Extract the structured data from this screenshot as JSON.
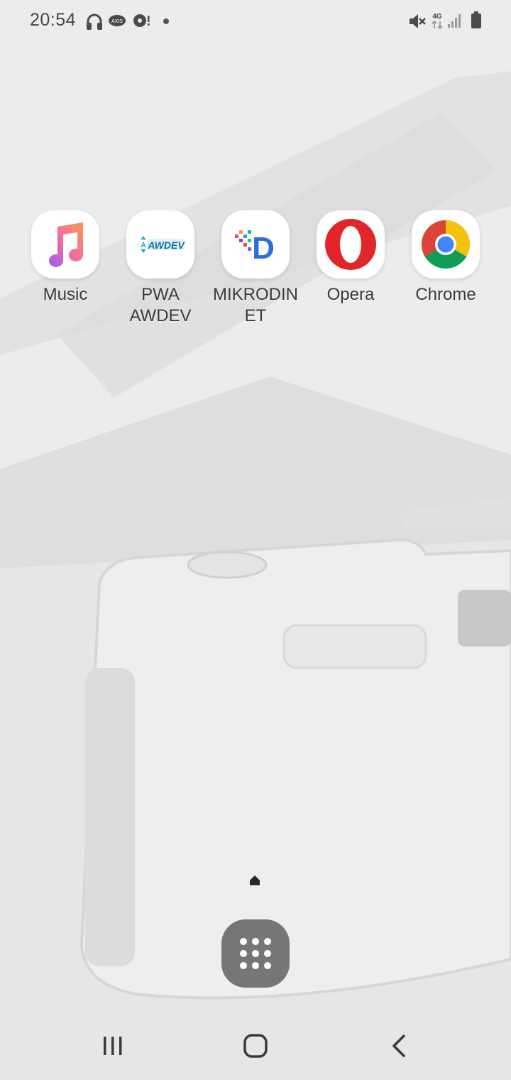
{
  "status_bar": {
    "time": "20:54",
    "carrier_badge": "AXIS",
    "network_type": "4G",
    "left_icons": [
      "headphones-icon",
      "carrier-axis-icon",
      "chat-bubble-icon",
      "notification-dot"
    ],
    "right_icons": [
      "mute-icon",
      "network-4g-icon",
      "signal-icon",
      "battery-icon"
    ]
  },
  "apps": [
    {
      "label": "Music",
      "icon": "music-note-icon"
    },
    {
      "label": "PWA AWDEV",
      "icon": "awdev-logo-icon",
      "logo_text": "AWDEV"
    },
    {
      "label": "MIKRODINET",
      "icon": "mikrodinet-logo-icon",
      "logo_text": "D"
    },
    {
      "label": "Opera",
      "icon": "opera-icon"
    },
    {
      "label": "Chrome",
      "icon": "chrome-icon"
    }
  ],
  "page_indicator": {
    "type": "home",
    "icon": "home-dot-icon"
  },
  "app_drawer": {
    "icon": "grid-dots-icon"
  },
  "navigation": {
    "buttons": [
      "recent-apps",
      "home",
      "back"
    ]
  },
  "colors": {
    "opera_red": "#e0252b",
    "chrome_red": "#db4437",
    "chrome_yellow": "#f4c20d",
    "chrome_green": "#0f9d58",
    "chrome_blue": "#4285f4",
    "drawer_bg": "#767676"
  }
}
